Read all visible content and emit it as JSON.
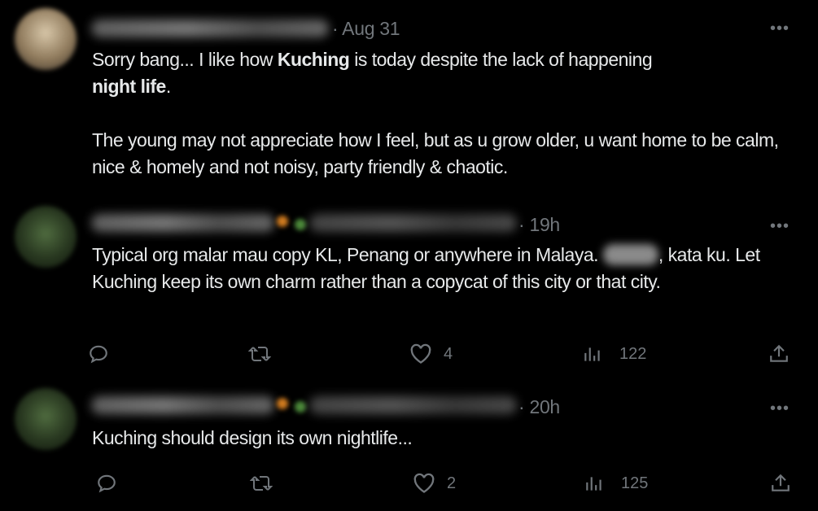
{
  "tweets": [
    {
      "time": "· Aug 31",
      "more": "•••",
      "text_l1_a": "Sorry bang... I like how ",
      "text_l1_b": "Kuching",
      "text_l1_c": " is today despite the lack of happening",
      "text_l2_b": "night life",
      "text_l2_c": ".",
      "text_p2": "The young may not appreciate how I feel, but as u grow older, u want home to be calm, nice & homely and not noisy, party friendly & chaotic."
    },
    {
      "time": "· 19h",
      "more": "•••",
      "text_a": "Typical org malar mau copy KL, Penang or anywhere in Malaya. ",
      "text_b": ", kata ku. Let Kuching keep its own charm rather than a copycat of this city or that city.",
      "likes": "4",
      "views": "122"
    },
    {
      "time": "· 20h",
      "more": "•••",
      "text": "Kuching should design its own nightlife...",
      "likes": "2",
      "views": "125"
    }
  ],
  "icons": [
    "reply-icon",
    "retweet-icon",
    "like-icon",
    "views-icon",
    "share-icon"
  ]
}
